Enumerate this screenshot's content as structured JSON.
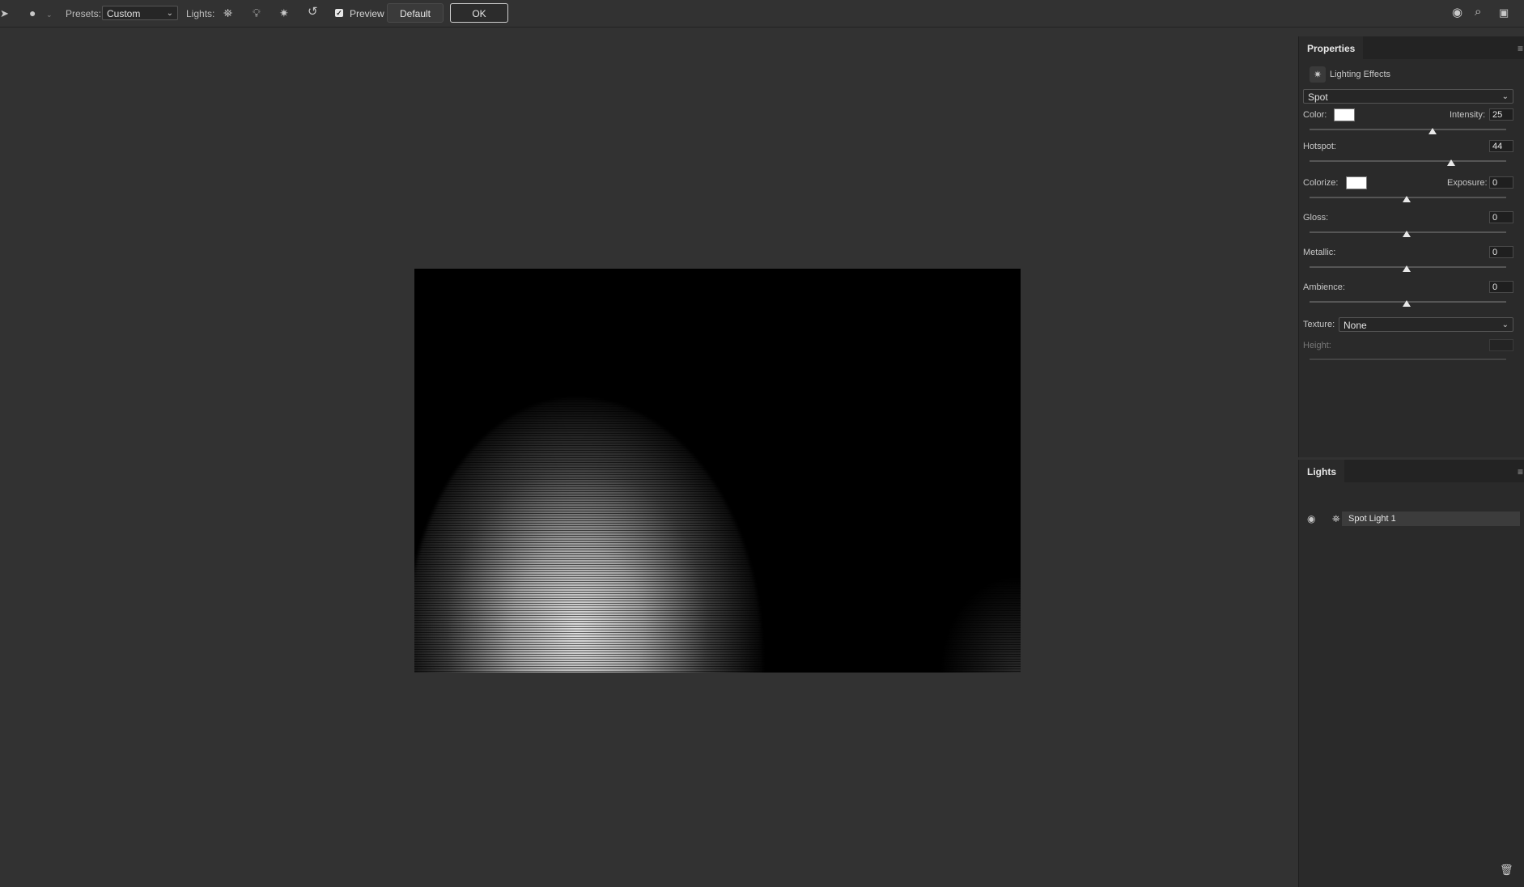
{
  "toolbar": {
    "presets_label": "Presets:",
    "presets_value": "Custom",
    "lights_label": "Lights:",
    "preview_label": "Preview",
    "preview_checked": true,
    "default_button": "Default",
    "ok_button": "OK"
  },
  "properties": {
    "tab_title": "Properties",
    "header": "Lighting Effects",
    "light_type": "Spot",
    "color_label": "Color:",
    "intensity_label": "Intensity:",
    "intensity_value": "25",
    "hotspot_label": "Hotspot:",
    "hotspot_value": "44",
    "colorize_label": "Colorize:",
    "exposure_label": "Exposure:",
    "exposure_value": "0",
    "gloss_label": "Gloss:",
    "gloss_value": "0",
    "metallic_label": "Metallic:",
    "metallic_value": "0",
    "ambience_label": "Ambience:",
    "ambience_value": "0",
    "texture_label": "Texture:",
    "texture_value": "None",
    "height_label": "Height:",
    "height_value": ""
  },
  "lights_panel": {
    "tab_title": "Lights",
    "items": [
      {
        "name": "Spot Light 1",
        "visible": true
      }
    ]
  },
  "colors": {
    "background": "#323232",
    "panel": "#2a2a2a",
    "swatch_color": "#ffffff",
    "colorize_color": "#ffffff"
  },
  "icons": {
    "move_tool": "move-tool-icon",
    "light_bulb": "light-bulb-icon",
    "spot_light": "spot-light-icon",
    "point_light": "point-light-icon",
    "infinite_light": "infinite-light-icon",
    "reset": "reset-icon",
    "user": "user-icon",
    "search": "search-icon",
    "workspace": "workspace-icon",
    "eye": "eye-icon",
    "trash": "trash-icon"
  }
}
